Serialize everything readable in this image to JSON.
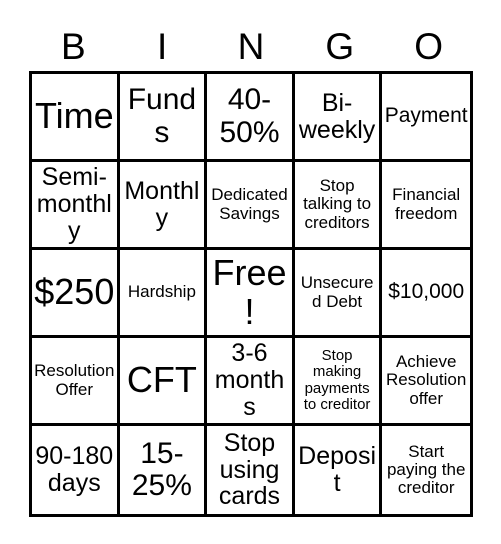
{
  "card": {
    "header_letters": [
      "B",
      "I",
      "N",
      "G",
      "O"
    ],
    "free_space_label": "Free!",
    "colors": {
      "background": "#ffffff",
      "text": "#000000",
      "border": "#000000"
    },
    "rows": [
      [
        {
          "text": "Time",
          "size": "sz-xl"
        },
        {
          "text": "Funds",
          "size": "sz-lg"
        },
        {
          "text": "40-50%",
          "size": "sz-lg"
        },
        {
          "text": "Bi-weekly",
          "size": "sz-md"
        },
        {
          "text": "Payment",
          "size": "sz-sm"
        }
      ],
      [
        {
          "text": "Semi-monthly",
          "size": "sz-md"
        },
        {
          "text": "Monthly",
          "size": "sz-md"
        },
        {
          "text": "Dedicated Savings",
          "size": "sz-xs"
        },
        {
          "text": "Stop talking to creditors",
          "size": "sz-xs"
        },
        {
          "text": "Financial freedom",
          "size": "sz-xs"
        }
      ],
      [
        {
          "text": "$250",
          "size": "sz-xl"
        },
        {
          "text": "Hardship",
          "size": "sz-xs"
        },
        {
          "text": "Free!",
          "size": "sz-xl"
        },
        {
          "text": "Unsecured Debt",
          "size": "sz-xs"
        },
        {
          "text": "$10,000",
          "size": "sz-sm"
        }
      ],
      [
        {
          "text": "Resolution Offer",
          "size": "sz-xs"
        },
        {
          "text": "CFT",
          "size": "sz-xl"
        },
        {
          "text": "3-6 months",
          "size": "sz-md"
        },
        {
          "text": "Stop making payments to creditor",
          "size": "sz-xxs"
        },
        {
          "text": "Achieve Resolution offer",
          "size": "sz-xs"
        }
      ],
      [
        {
          "text": "90-180 days",
          "size": "sz-md"
        },
        {
          "text": "15-25%",
          "size": "sz-lg"
        },
        {
          "text": "Stop using cards",
          "size": "sz-md"
        },
        {
          "text": "Deposit",
          "size": "sz-md"
        },
        {
          "text": "Start paying the creditor",
          "size": "sz-xs"
        }
      ]
    ]
  }
}
